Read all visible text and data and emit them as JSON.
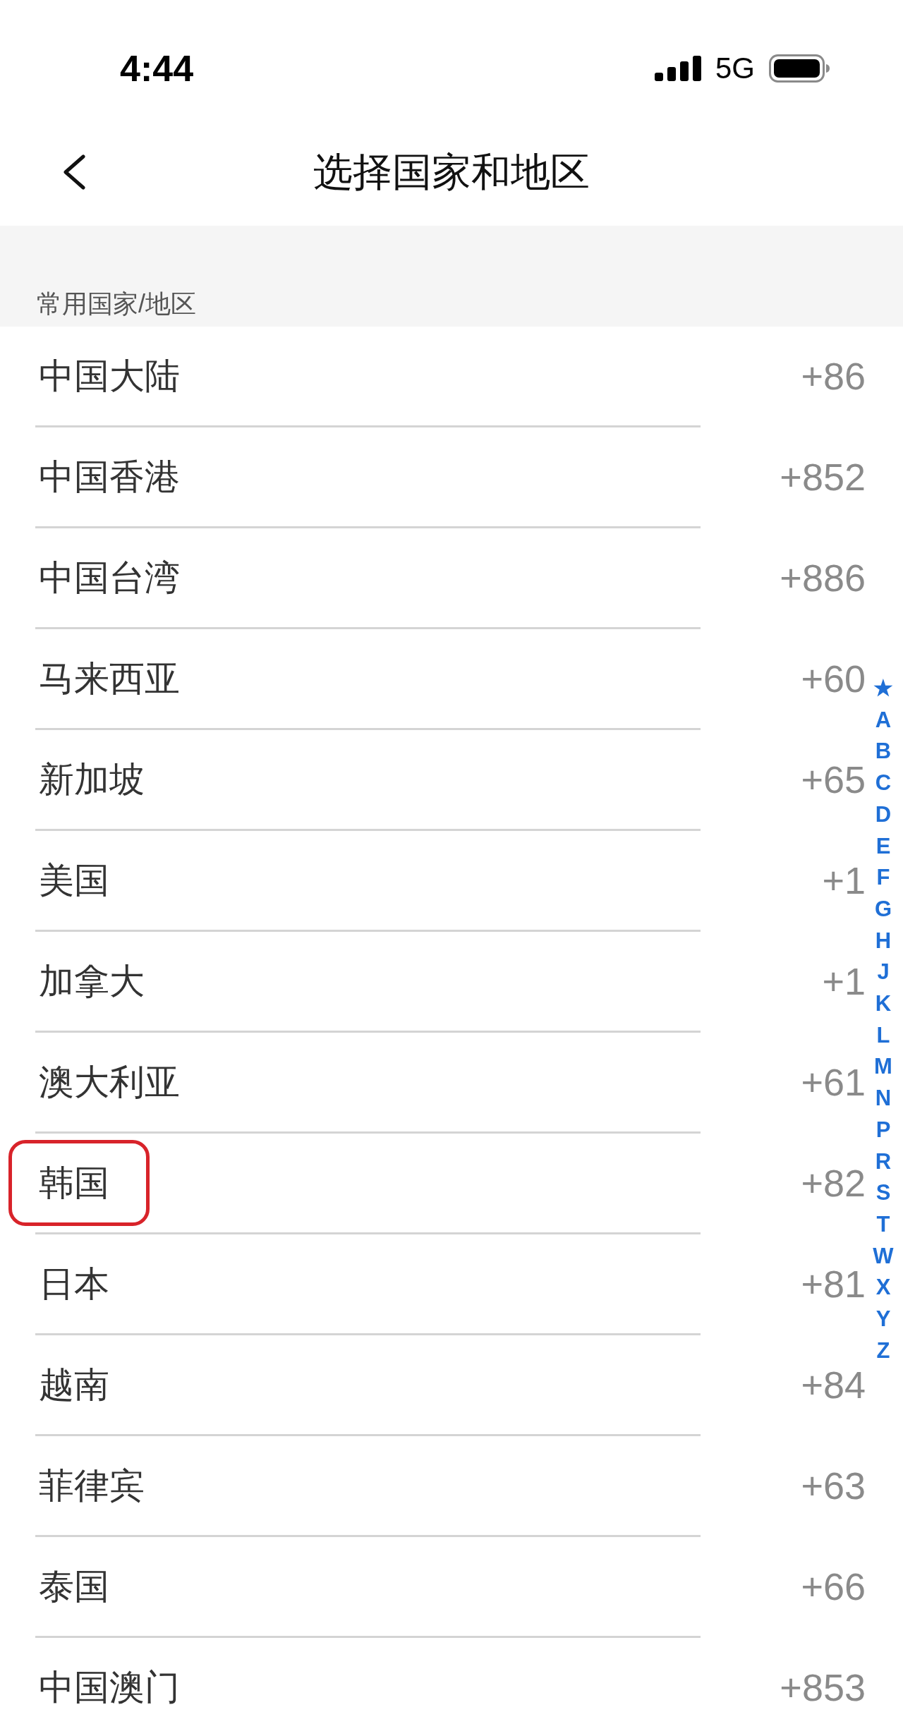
{
  "status_bar": {
    "time": "4:44",
    "network": "5G"
  },
  "header": {
    "title": "选择国家和地区"
  },
  "section": {
    "label": "常用国家/地区"
  },
  "rows": [
    {
      "name": "中国大陆",
      "code": "+86",
      "highlighted": false
    },
    {
      "name": "中国香港",
      "code": "+852",
      "highlighted": false
    },
    {
      "name": "中国台湾",
      "code": "+886",
      "highlighted": false
    },
    {
      "name": "马来西亚",
      "code": "+60",
      "highlighted": false
    },
    {
      "name": "新加坡",
      "code": "+65",
      "highlighted": false
    },
    {
      "name": "美国",
      "code": "+1",
      "highlighted": false
    },
    {
      "name": "加拿大",
      "code": "+1",
      "highlighted": false
    },
    {
      "name": "澳大利亚",
      "code": "+61",
      "highlighted": false
    },
    {
      "name": "韩国",
      "code": "+82",
      "highlighted": true
    },
    {
      "name": "日本",
      "code": "+81",
      "highlighted": false
    },
    {
      "name": "越南",
      "code": "+84",
      "highlighted": false
    },
    {
      "name": "菲律宾",
      "code": "+63",
      "highlighted": false
    },
    {
      "name": "泰国",
      "code": "+66",
      "highlighted": false
    },
    {
      "name": "中国澳门",
      "code": "+853",
      "highlighted": false
    }
  ],
  "index": [
    "★",
    "A",
    "B",
    "C",
    "D",
    "E",
    "F",
    "G",
    "H",
    "J",
    "K",
    "L",
    "M",
    "N",
    "P",
    "R",
    "S",
    "T",
    "W",
    "X",
    "Y",
    "Z"
  ]
}
